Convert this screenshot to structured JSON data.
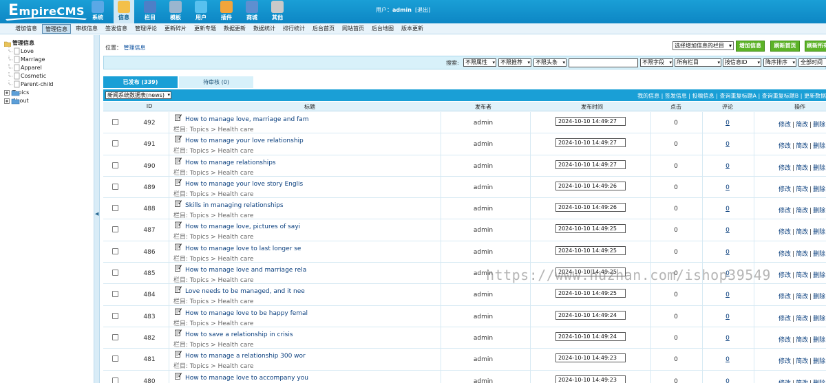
{
  "app": {
    "logo_text_big": "E",
    "logo_text": "mpireCMS",
    "accent": "#1a9fd6",
    "nav": [
      {
        "label": "系统",
        "icon": "system-icon"
      },
      {
        "label": "信息",
        "icon": "info-icon",
        "active": true
      },
      {
        "label": "栏目",
        "icon": "column-icon"
      },
      {
        "label": "模板",
        "icon": "template-icon"
      },
      {
        "label": "用户",
        "icon": "user-icon"
      },
      {
        "label": "插件",
        "icon": "plugin-icon"
      },
      {
        "label": "商城",
        "icon": "shop-icon"
      },
      {
        "label": "其他",
        "icon": "gear-icon"
      }
    ],
    "user": {
      "prefix": "用户：",
      "name": "admin",
      "logout": "[退出]"
    }
  },
  "submenu": [
    "增加信息",
    "管理信息",
    "审核信息",
    "签发信息",
    "管理评论",
    "更新碎片",
    "更新专题",
    "数据更新",
    "数据统计",
    "排行统计",
    "后台首页",
    "网站首页",
    "后台地图",
    "版本更新"
  ],
  "submenu_active": "管理信息",
  "sidebar": {
    "root": "管理信息",
    "items": [
      {
        "label": "Love",
        "type": "leaf"
      },
      {
        "label": "Marriage",
        "type": "leaf"
      },
      {
        "label": "Apparel",
        "type": "leaf"
      },
      {
        "label": "Cosmetic",
        "type": "leaf"
      },
      {
        "label": "Parent-child",
        "type": "leaf"
      },
      {
        "label": "Topics",
        "type": "folder"
      },
      {
        "label": "About",
        "type": "folder"
      }
    ]
  },
  "location": {
    "label": "位置：",
    "link": "管理信息"
  },
  "toolbar": {
    "category_select": "选择增加信息的栏目",
    "add_button": "增加信息",
    "refresh_home": "刷新首页",
    "refresh_all": "刷新所有"
  },
  "search": {
    "label": "搜索:",
    "attr": "不限属性",
    "recommend": "不限推荐",
    "headline": "不限头条",
    "field": "不限字段",
    "columns": "所有栏目",
    "order_by": "按信息ID",
    "sort": "降序排序",
    "time": "全部时间"
  },
  "tabs": {
    "published": "已发布 (339)",
    "pending": "待审核 (0)"
  },
  "table_bar": {
    "table_select": "新闻系统数据表(news)",
    "links": [
      "我的信息",
      "签发信息",
      "投稿信息",
      "查询重复标题A",
      "查询重复标题B",
      "更新数据"
    ]
  },
  "columns": {
    "id": "ID",
    "title": "标题",
    "author": "发布者",
    "time": "发布时间",
    "hits": "点击",
    "comments": "评论",
    "ops": "操作"
  },
  "category_prefix": "栏目: Topics > Health care",
  "op_labels": {
    "edit": "修改",
    "simple_edit": "简改",
    "delete": "删除"
  },
  "rows": [
    {
      "id": "492",
      "title": "How to manage love, marriage and fam",
      "author": "admin",
      "time": "2024-10-10 14:49:27",
      "hits": "0",
      "comments": "0"
    },
    {
      "id": "491",
      "title": "How to manage your love relationship",
      "author": "admin",
      "time": "2024-10-10 14:49:27",
      "hits": "0",
      "comments": "0"
    },
    {
      "id": "490",
      "title": "How to manage relationships",
      "author": "admin",
      "time": "2024-10-10 14:49:27",
      "hits": "0",
      "comments": "0"
    },
    {
      "id": "489",
      "title": "How to manage your love story Englis",
      "author": "admin",
      "time": "2024-10-10 14:49:26",
      "hits": "0",
      "comments": "0"
    },
    {
      "id": "488",
      "title": "Skills in managing relationships",
      "author": "admin",
      "time": "2024-10-10 14:49:26",
      "hits": "0",
      "comments": "0"
    },
    {
      "id": "487",
      "title": "How to manage love, pictures of sayi",
      "author": "admin",
      "time": "2024-10-10 14:49:25",
      "hits": "0",
      "comments": "0"
    },
    {
      "id": "486",
      "title": "How to manage love to last longer se",
      "author": "admin",
      "time": "2024-10-10 14:49:25",
      "hits": "0",
      "comments": "0"
    },
    {
      "id": "485",
      "title": "How to manage love and marriage rela",
      "author": "admin",
      "time": "2024-10-10 14:49:25",
      "hits": "0",
      "comments": "0"
    },
    {
      "id": "484",
      "title": "Love needs to be managed, and it nee",
      "author": "admin",
      "time": "2024-10-10 14:49:25",
      "hits": "0",
      "comments": "0"
    },
    {
      "id": "483",
      "title": "How to manage love to be happy femal",
      "author": "admin",
      "time": "2024-10-10 14:49:24",
      "hits": "0",
      "comments": "0"
    },
    {
      "id": "482",
      "title": "How to save a relationship in crisis",
      "author": "admin",
      "time": "2024-10-10 14:49:24",
      "hits": "0",
      "comments": "0"
    },
    {
      "id": "481",
      "title": "How to manage a relationship 300 wor",
      "author": "admin",
      "time": "2024-10-10 14:49:23",
      "hits": "0",
      "comments": "0"
    },
    {
      "id": "480",
      "title": "How to manage love to accompany you",
      "author": "admin",
      "time": "2024-10-10 14:49:23",
      "hits": "0",
      "comments": "0"
    }
  ],
  "watermark": "https://www.huzhan.com/ishop39549"
}
